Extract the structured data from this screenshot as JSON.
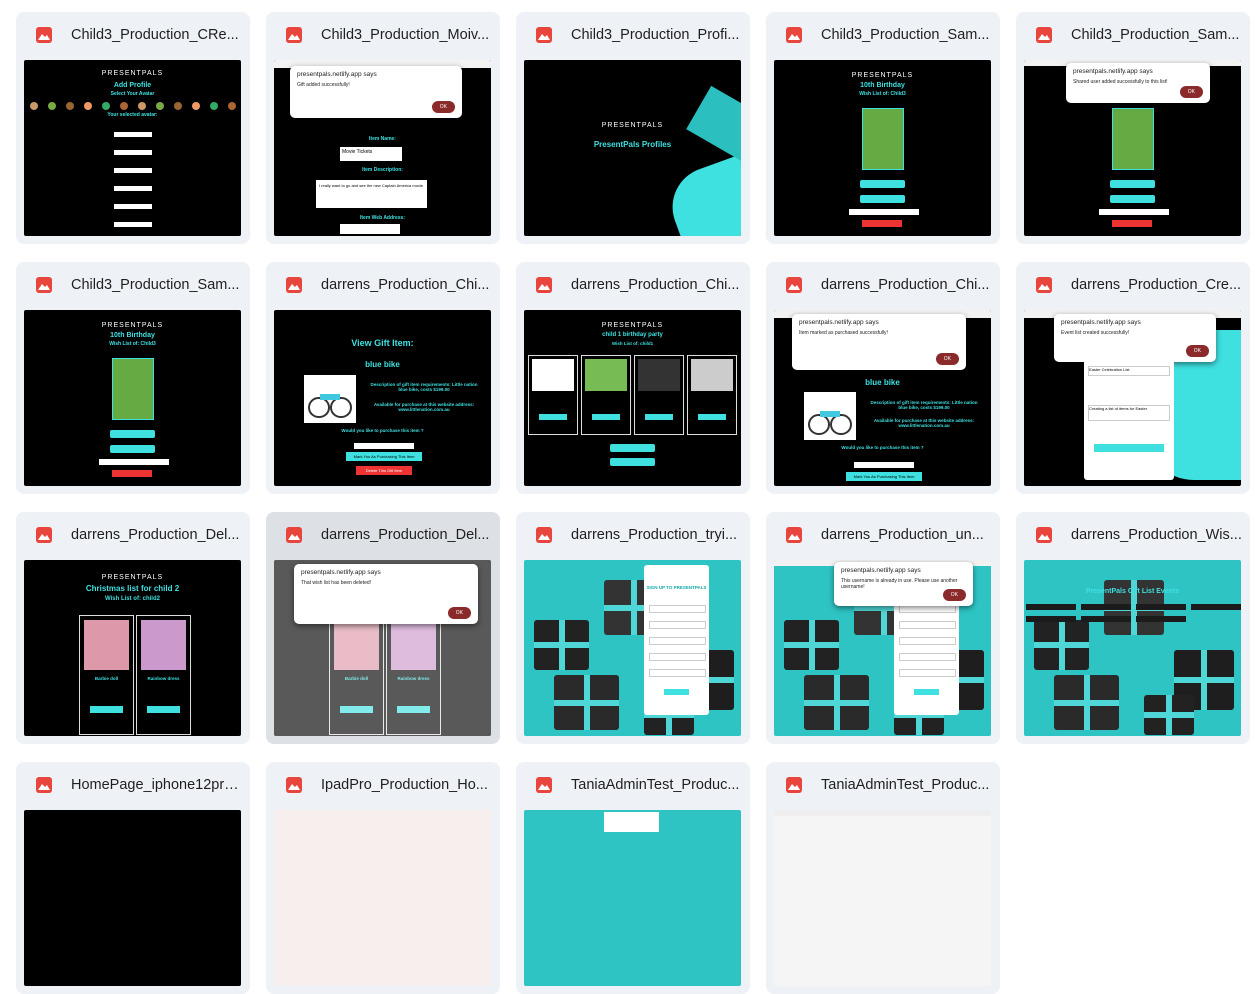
{
  "files": [
    {
      "name": "Child3_Production_CRe...",
      "kind": "add-profile"
    },
    {
      "name": "Child3_Production_Moiv...",
      "kind": "dialog-movie"
    },
    {
      "name": "Child3_Production_Profi...",
      "kind": "profiles"
    },
    {
      "name": "Child3_Production_Sam...",
      "kind": "birthday"
    },
    {
      "name": "Child3_Production_Sam...",
      "kind": "birthday-dialog"
    },
    {
      "name": "Child3_Production_Sam...",
      "kind": "birthday"
    },
    {
      "name": "darrens_Production_Chi...",
      "kind": "view-gift"
    },
    {
      "name": "darrens_Production_Chi...",
      "kind": "party"
    },
    {
      "name": "darrens_Production_Chi...",
      "kind": "purchased-dialog"
    },
    {
      "name": "darrens_Production_Cre...",
      "kind": "create-list"
    },
    {
      "name": "darrens_Production_Del...",
      "kind": "christmas"
    },
    {
      "name": "darrens_Production_Del...",
      "kind": "deleted-dialog"
    },
    {
      "name": "darrens_Production_tryi...",
      "kind": "signup"
    },
    {
      "name": "darrens_Production_un...",
      "kind": "signup-dialog"
    },
    {
      "name": "darrens_Production_Wis...",
      "kind": "events"
    },
    {
      "name": "HomePage_iphone12pro...",
      "kind": "black"
    },
    {
      "name": "IpadPro_Production_Ho...",
      "kind": "ipad"
    },
    {
      "name": "TaniaAdminTest_Produc...",
      "kind": "teal"
    },
    {
      "name": "TaniaAdminTest_Produc...",
      "kind": "teal-dialog"
    }
  ],
  "thumb_text": {
    "brand": "PRESENTPALS",
    "add_profile": "Add Profile",
    "select_avatar": "Select Your Avatar",
    "your_avatar": "Your selected avatar:",
    "dialog_site": "presentpals.netlify.app says",
    "gift_added": "Gift added successfully!",
    "ok": "OK",
    "item_name": "Item Name:",
    "movie_tickets": "Movie Tickets",
    "item_desc": "Item Description:",
    "movie_desc": "I really want to go and see the new Captain America movie",
    "item_web": "Item Web Address:",
    "profiles_title": "PresentPals Profiles",
    "birthday": "10th Birthday",
    "wish_child3": "Wish List of: Child3",
    "shared_ok": "Shared user added successfully to this list!",
    "view_gift": "View Gift Item:",
    "blue_bike": "blue bike",
    "bike_desc": "Description of gift item requirements: Little nation blue bike, costs $199.00",
    "bike_site": "Available for purchase at this website address: www.littlenation.com.au",
    "purchase_q": "Would you like to purchase this item ?",
    "confirm": "Confirm this option:",
    "mark_btn": "Mark You As Purchasing This Item",
    "delete_btn": "Delete This Gift Item",
    "party_title": "child 1 birthday party",
    "wish_child1": "Wish List of: child1",
    "purchased_ok": "Item marked as purchased successfully!",
    "event_ok": "Event list created successfully!",
    "create_title": "Easter Celebration List",
    "create_desc": "Creating a list of items for Easter",
    "christmas": "Christmas list for child 2",
    "wish_child2": "Wish List of: child2",
    "barbie": "Barbie doll",
    "rainbow": "Rainbow dress",
    "list_deleted": "That wish list has been deleted!",
    "signup": "SIGN UP TO PRESENTPALS",
    "user_exists": "This username is already in use. Please use another username!",
    "events_title": "PresentPals Gift List Events"
  }
}
